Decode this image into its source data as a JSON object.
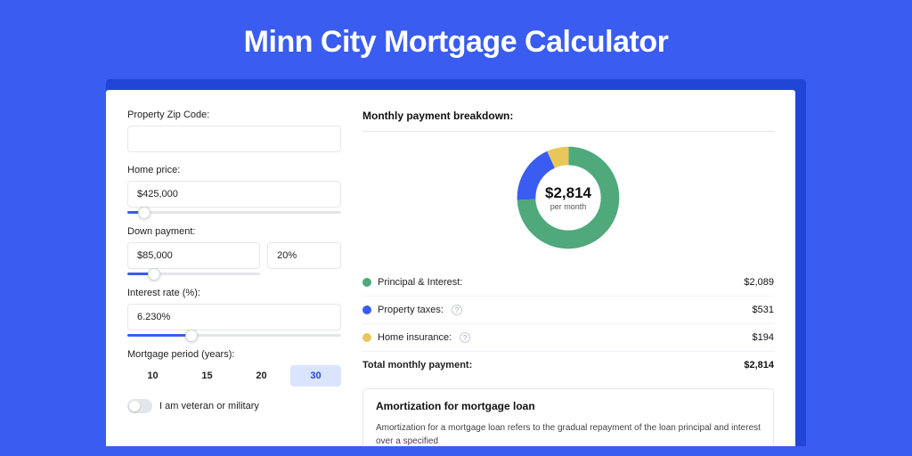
{
  "hero": {
    "title": "Minn City Mortgage Calculator"
  },
  "form": {
    "zip": {
      "label": "Property Zip Code:",
      "value": ""
    },
    "homePrice": {
      "label": "Home price:",
      "value": "$425,000",
      "sliderPct": 8
    },
    "downPayment": {
      "label": "Down payment:",
      "amount": "$85,000",
      "percent": "20%",
      "sliderPct": 20
    },
    "interestRate": {
      "label": "Interest rate (%):",
      "value": "6.230%",
      "sliderPct": 30
    },
    "period": {
      "label": "Mortgage period (years):",
      "options": [
        "10",
        "15",
        "20",
        "30"
      ],
      "active": 3
    },
    "veteran": {
      "label": "I am veteran or military",
      "on": false
    }
  },
  "breakdown": {
    "title": "Monthly payment breakdown:",
    "donut": {
      "amount": "$2,814",
      "sub": "per month"
    },
    "lines": [
      {
        "color": "green",
        "label": "Principal & Interest:",
        "help": false,
        "amount": "$2,089"
      },
      {
        "color": "blue",
        "label": "Property taxes:",
        "help": true,
        "amount": "$531"
      },
      {
        "color": "yellow",
        "label": "Home insurance:",
        "help": true,
        "amount": "$194"
      }
    ],
    "total": {
      "label": "Total monthly payment:",
      "amount": "$2,814"
    }
  },
  "amortization": {
    "title": "Amortization for mortgage loan",
    "text": "Amortization for a mortgage loan refers to the gradual repayment of the loan principal and interest over a specified"
  },
  "chart_data": {
    "type": "pie",
    "title": "Monthly payment breakdown",
    "series": [
      {
        "name": "Principal & Interest",
        "value": 2089,
        "color": "#4fa97b"
      },
      {
        "name": "Property taxes",
        "value": 531,
        "color": "#3a5cf0"
      },
      {
        "name": "Home insurance",
        "value": 194,
        "color": "#e9c65a"
      }
    ],
    "total": 2814,
    "unit": "$"
  }
}
